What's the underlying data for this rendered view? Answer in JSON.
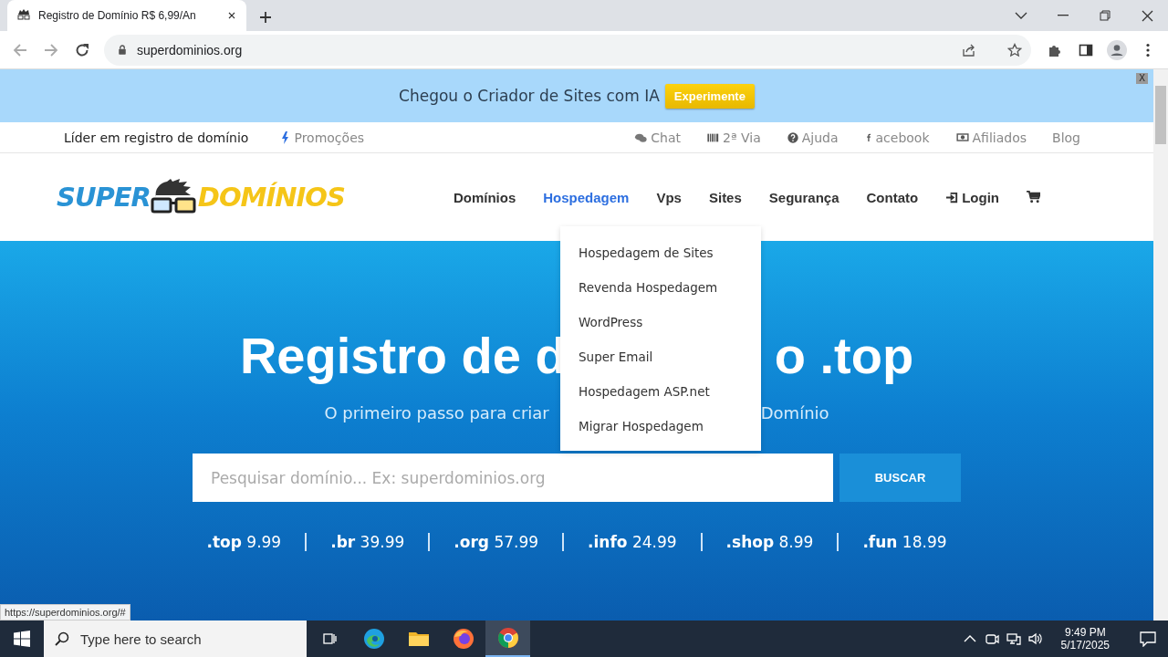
{
  "browser": {
    "tab_title": "Registro de Domínio R$ 6,99/An",
    "url": "superdominios.org",
    "status_url": "https://superdominios.org/#"
  },
  "banner": {
    "text": "Chegou o Criador de Sites com IA",
    "button": "Experimente",
    "close": "X"
  },
  "topbar": {
    "tagline": "Líder em registro de domínio",
    "promo": "Promoções",
    "links": [
      {
        "kind": "chat",
        "label": "Chat"
      },
      {
        "kind": "barcode",
        "label": "2ª Via"
      },
      {
        "kind": "help",
        "label": "Ajuda"
      },
      {
        "kind": "facebook",
        "label": "acebook"
      },
      {
        "kind": "money",
        "label": "Afiliados"
      },
      {
        "kind": "plain",
        "label": "Blog"
      }
    ]
  },
  "logo": {
    "left": "SUPER",
    "right": "DOMÍNIOS"
  },
  "nav": [
    {
      "label": "Domínios",
      "selected": false,
      "kind": "plain"
    },
    {
      "label": "Hospedagem",
      "selected": true,
      "kind": "plain"
    },
    {
      "label": "Vps",
      "selected": false,
      "kind": "plain"
    },
    {
      "label": "Sites",
      "selected": false,
      "kind": "plain"
    },
    {
      "label": "Segurança",
      "selected": false,
      "kind": "plain"
    },
    {
      "label": "Contato",
      "selected": false,
      "kind": "plain"
    },
    {
      "label": "Login",
      "selected": false,
      "kind": "login"
    },
    {
      "kind": "cart",
      "selected": false
    }
  ],
  "dropdown": [
    "Hospedagem de Sites",
    "Revenda Hospedagem",
    "WordPress",
    "Super Email",
    "Hospedagem ASP.net",
    "Migrar Hospedagem"
  ],
  "hero": {
    "title_start": "Registro de d",
    "title_end": "o .top",
    "subtitle_start": "O primeiro passo para criar",
    "subtitle_end": "Domínio",
    "search_placeholder": "Pesquisar domínio... Ex: superdominios.org",
    "search_button": "BUSCAR",
    "prices": [
      {
        "tld": ".top",
        "price": "9.99"
      },
      {
        "tld": ".br",
        "price": "39.99"
      },
      {
        "tld": ".org",
        "price": "57.99"
      },
      {
        "tld": ".info",
        "price": "24.99"
      },
      {
        "tld": ".shop",
        "price": "8.99"
      },
      {
        "tld": ".fun",
        "price": "18.99"
      }
    ]
  },
  "taskbar": {
    "search_placeholder": "Type here to search",
    "time": "9:49 PM",
    "date": "5/17/2025",
    "apps": [
      {
        "kind": "taskview",
        "selected": false
      },
      {
        "kind": "edge",
        "selected": false
      },
      {
        "kind": "files",
        "selected": false
      },
      {
        "kind": "firefox",
        "selected": false
      },
      {
        "kind": "chrome",
        "selected": true
      }
    ]
  }
}
